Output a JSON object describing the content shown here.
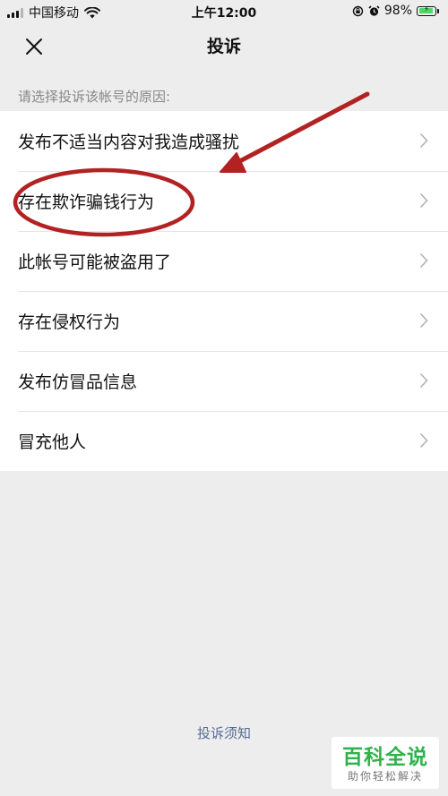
{
  "status_bar": {
    "carrier": "中国移动",
    "time": "上午12:00",
    "battery": "98%",
    "battery_level": 0.98,
    "icons": [
      "signal-icon",
      "wifi-icon",
      "orientation-lock-icon",
      "alarm-icon",
      "battery-icon"
    ]
  },
  "nav": {
    "title": "投诉",
    "close_icon": "close-icon"
  },
  "section_hint": "请选择投诉该帐号的原因:",
  "reasons": [
    {
      "label": "发布不适当内容对我造成骚扰"
    },
    {
      "label": "存在欺诈骗钱行为"
    },
    {
      "label": "此帐号可能被盗用了"
    },
    {
      "label": "存在侵权行为"
    },
    {
      "label": "发布仿冒品信息"
    },
    {
      "label": "冒充他人"
    }
  ],
  "footer": {
    "notice_link": "投诉须知"
  },
  "annotation": {
    "color": "#b22222",
    "highlighted_item_index": 1
  },
  "watermark": {
    "title": "百科全说",
    "subtitle": "助你轻松解决",
    "color": "#2fb24b"
  }
}
